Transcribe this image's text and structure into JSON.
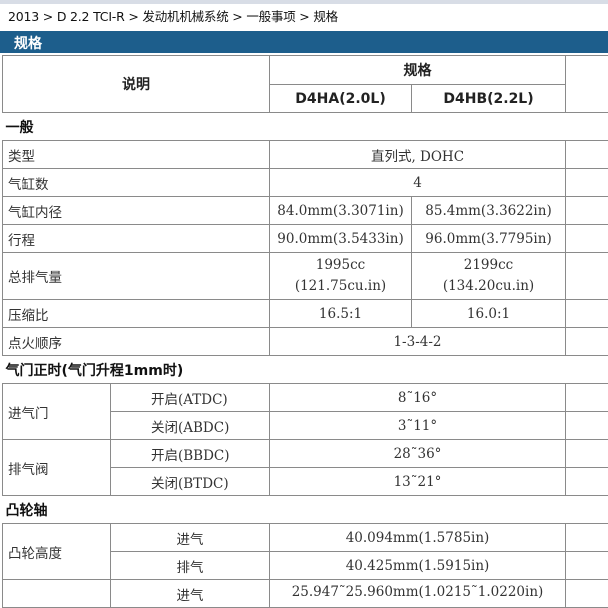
{
  "breadcrumb": "2013 > D 2.2 TCI-R > 发动机机械系统 > 一般事项 > 规格",
  "section_title": "规格",
  "table": {
    "col_desc": "说明",
    "col_spec": "规格",
    "col_a": "D4HA(2.0L)",
    "col_b": "D4HB(2.2L)",
    "general": {
      "title": "一般",
      "type_label": "类型",
      "type_value": "直列式, DOHC",
      "cyl_label": "气缸数",
      "cyl_value": "4",
      "bore_label": "气缸内径",
      "bore_a": "84.0mm(3.3071in)",
      "bore_b": "85.4mm(3.3622in)",
      "stroke_label": "行程",
      "stroke_a": "90.0mm(3.5433in)",
      "stroke_b": "96.0mm(3.7795in)",
      "disp_label": "总排气量",
      "disp_a1": "1995cc",
      "disp_a2": "(121.75cu.in)",
      "disp_b1": "2199cc",
      "disp_b2": "(134.20cu.in)",
      "cr_label": "压缩比",
      "cr_a": "16.5:1",
      "cr_b": "16.0:1",
      "fo_label": "点火顺序",
      "fo_value": "1-3-4-2"
    },
    "valve_timing": {
      "title": "气门正时(气门升程1mm时)",
      "intake_label": "进气门",
      "intake_open_label": "开启(ATDC)",
      "intake_open_value": "8˜16°",
      "intake_close_label": "关闭(ABDC)",
      "intake_close_value": "3˜11°",
      "exhaust_label": "排气阀",
      "exhaust_open_label": "开启(BBDC)",
      "exhaust_open_value": "28˜36°",
      "exhaust_close_label": "关闭(BTDC)",
      "exhaust_close_value": "13˜21°"
    },
    "camshaft": {
      "title": "凸轮轴",
      "lobe_label": "凸轮高度",
      "lobe_in_label": "进气",
      "lobe_in_value": "40.094mm(1.5785in)",
      "lobe_ex_label": "排气",
      "lobe_ex_value": "40.425mm(1.5915in)",
      "partial_label": "进气",
      "partial_value": "25.947˜25.960mm(1.0215˜1.0220in)"
    }
  }
}
